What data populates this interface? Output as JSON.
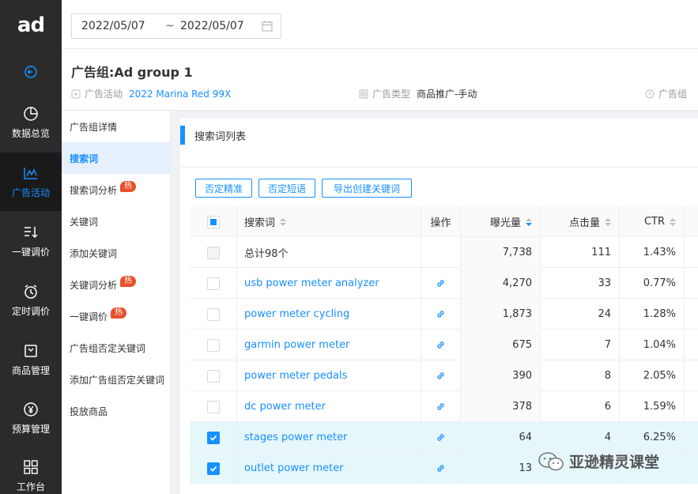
{
  "nav": {
    "logo": "ad",
    "items": [
      {
        "label": "数据总览",
        "icon": "pie-chart-icon"
      },
      {
        "label": "广告活动",
        "icon": "line-chart-icon",
        "active": true
      },
      {
        "label": "一键调价",
        "icon": "sort-list-icon"
      },
      {
        "label": "定时调价",
        "icon": "alarm-clock-icon"
      },
      {
        "label": "商品管理",
        "icon": "product-box-icon"
      },
      {
        "label": "预算管理",
        "icon": "yen-coin-icon"
      },
      {
        "label": "工作台",
        "icon": "grid-icon"
      }
    ]
  },
  "datepicker": {
    "start": "2022/05/07",
    "separator": "~",
    "end": "2022/05/07"
  },
  "header": {
    "title": "广告组:Ad group 1",
    "campaign_label": "广告活动",
    "campaign_value": "2022 Marina Red 99X",
    "type_label": "广告类型",
    "type_value": "商品推广-手动",
    "group_label": "广告组"
  },
  "subnav": {
    "hot_badge": "热",
    "items": [
      {
        "label": "广告组详情"
      },
      {
        "label": "搜索词",
        "active": true
      },
      {
        "label": "搜索词分析",
        "hot": true
      },
      {
        "label": "关键词"
      },
      {
        "label": "添加关键词"
      },
      {
        "label": "关键词分析",
        "hot": true
      },
      {
        "label": "一键调价",
        "hot": true
      },
      {
        "label": "广告组否定关键词"
      },
      {
        "label": "添加广告组否定关键词"
      },
      {
        "label": "投放商品"
      }
    ]
  },
  "section": {
    "title": "搜索词列表"
  },
  "buttons": {
    "negate_exact": "否定精准",
    "negate_phrase": "否定短语",
    "export_create": "导出创建关键词"
  },
  "table": {
    "columns": {
      "keyword": "搜索词",
      "action": "操作",
      "impressions": "曝光量",
      "clicks": "点击量",
      "ctr": "CTR"
    },
    "summary": {
      "label": "总计98个",
      "impressions": "7,738",
      "clicks": "111",
      "ctr": "1.43%"
    },
    "rows": [
      {
        "keyword": "usb power meter analyzer",
        "impressions": "4,270",
        "clicks": "33",
        "ctr": "0.77%",
        "checked": false
      },
      {
        "keyword": "power meter cycling",
        "impressions": "1,873",
        "clicks": "24",
        "ctr": "1.28%",
        "checked": false
      },
      {
        "keyword": "garmin power meter",
        "impressions": "675",
        "clicks": "7",
        "ctr": "1.04%",
        "checked": false
      },
      {
        "keyword": "power meter pedals",
        "impressions": "390",
        "clicks": "8",
        "ctr": "2.05%",
        "checked": false
      },
      {
        "keyword": "dc power meter",
        "impressions": "378",
        "clicks": "6",
        "ctr": "1.59%",
        "checked": false
      },
      {
        "keyword": "stages power meter",
        "impressions": "64",
        "clicks": "4",
        "ctr": "6.25%",
        "checked": true
      },
      {
        "keyword": "outlet power meter",
        "impressions": "13",
        "clicks": "",
        "ctr": "",
        "checked": true
      }
    ]
  },
  "watermark": "亚逊精灵课堂",
  "colors": {
    "accent": "#1890ff",
    "nav_bg": "#2b2b2b",
    "hot": "#e8502b",
    "selected_row": "#e6f7fb"
  }
}
